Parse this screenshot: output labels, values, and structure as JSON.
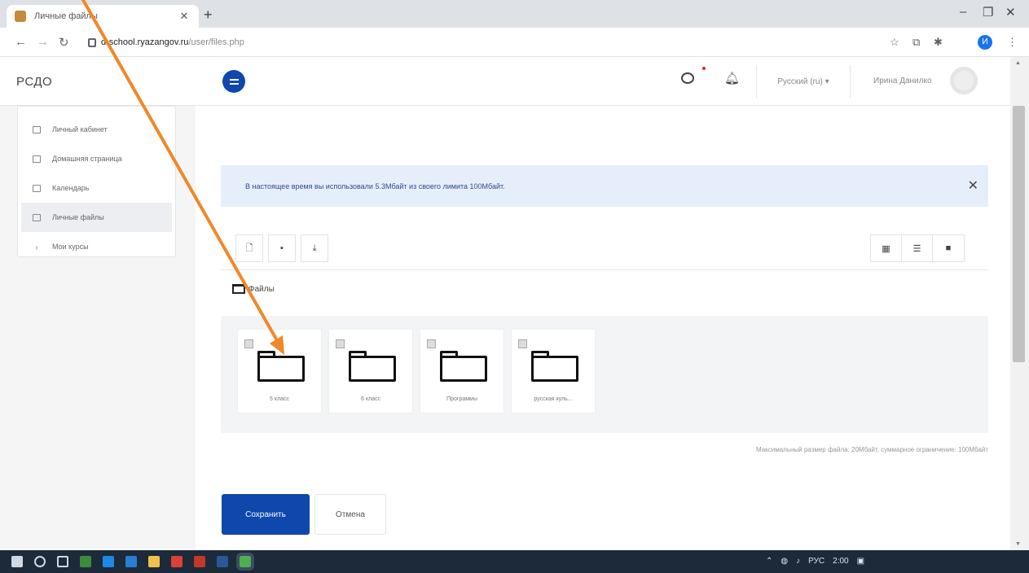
{
  "browser": {
    "tab_title": "Личные файлы",
    "url_host": "d-school.ryazangov.ru",
    "url_path": "/user/files.php",
    "profile_initial": "И"
  },
  "header": {
    "brand": "РСДО",
    "language": "Русский (ru) ▾",
    "user_name": "Ирина Данилко"
  },
  "sidebar": {
    "items": [
      {
        "label": "Личный кабинет",
        "icon": "dashboard-icon"
      },
      {
        "label": "Домашняя страница",
        "icon": "home-icon"
      },
      {
        "label": "Календарь",
        "icon": "calendar-icon"
      },
      {
        "label": "Личные файлы",
        "icon": "files-icon",
        "active": true
      },
      {
        "label": "Мои курсы",
        "icon": "chevron-icon"
      }
    ]
  },
  "alert": {
    "text": "В настоящее время вы использовали 5.3Мбайт из своего лимита 100Мбайт."
  },
  "path": {
    "label": "Файлы"
  },
  "files": [
    {
      "name": "5 класс"
    },
    {
      "name": "6 класс"
    },
    {
      "name": "Программы"
    },
    {
      "name": "русская куль..."
    }
  ],
  "limits_text": "Максимальный размер файла: 20Мбайт, суммарное ограничение: 100Мбайт",
  "actions": {
    "save": "Сохранить",
    "cancel": "Отмена"
  },
  "taskbar": {
    "lang": "РУС",
    "time": "2:00"
  },
  "colors": {
    "primary": "#0f47ad",
    "alert_bg": "#e7eefb",
    "annotation_arrow": "#f0882a"
  }
}
